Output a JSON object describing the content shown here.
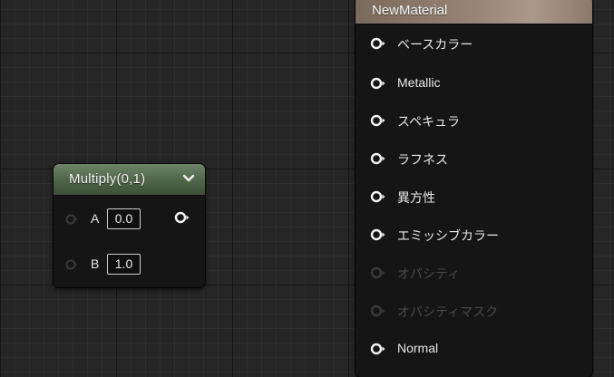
{
  "multiply_node": {
    "title": "Multiply(0,1)",
    "inputs": [
      {
        "label": "A",
        "value": "0.0"
      },
      {
        "label": "B",
        "value": "1.0"
      }
    ],
    "header_color": "#56704f"
  },
  "material_node": {
    "title": "NewMaterial",
    "header_color": "#968574",
    "inputs": [
      {
        "label": "ベースカラー",
        "enabled": true
      },
      {
        "label": "Metallic",
        "enabled": true
      },
      {
        "label": "スペキュラ",
        "enabled": true
      },
      {
        "label": "ラフネス",
        "enabled": true
      },
      {
        "label": "異方性",
        "enabled": true
      },
      {
        "label": "エミッシブカラー",
        "enabled": true
      },
      {
        "label": "オパシティ",
        "enabled": false
      },
      {
        "label": "オパシティマスク",
        "enabled": false
      },
      {
        "label": "Normal",
        "enabled": true
      }
    ]
  },
  "icons": {
    "input_pin": "circle-pin-icon",
    "output_pin": "circle-arrow-pin-icon",
    "collapse": "chevron-down-icon"
  }
}
